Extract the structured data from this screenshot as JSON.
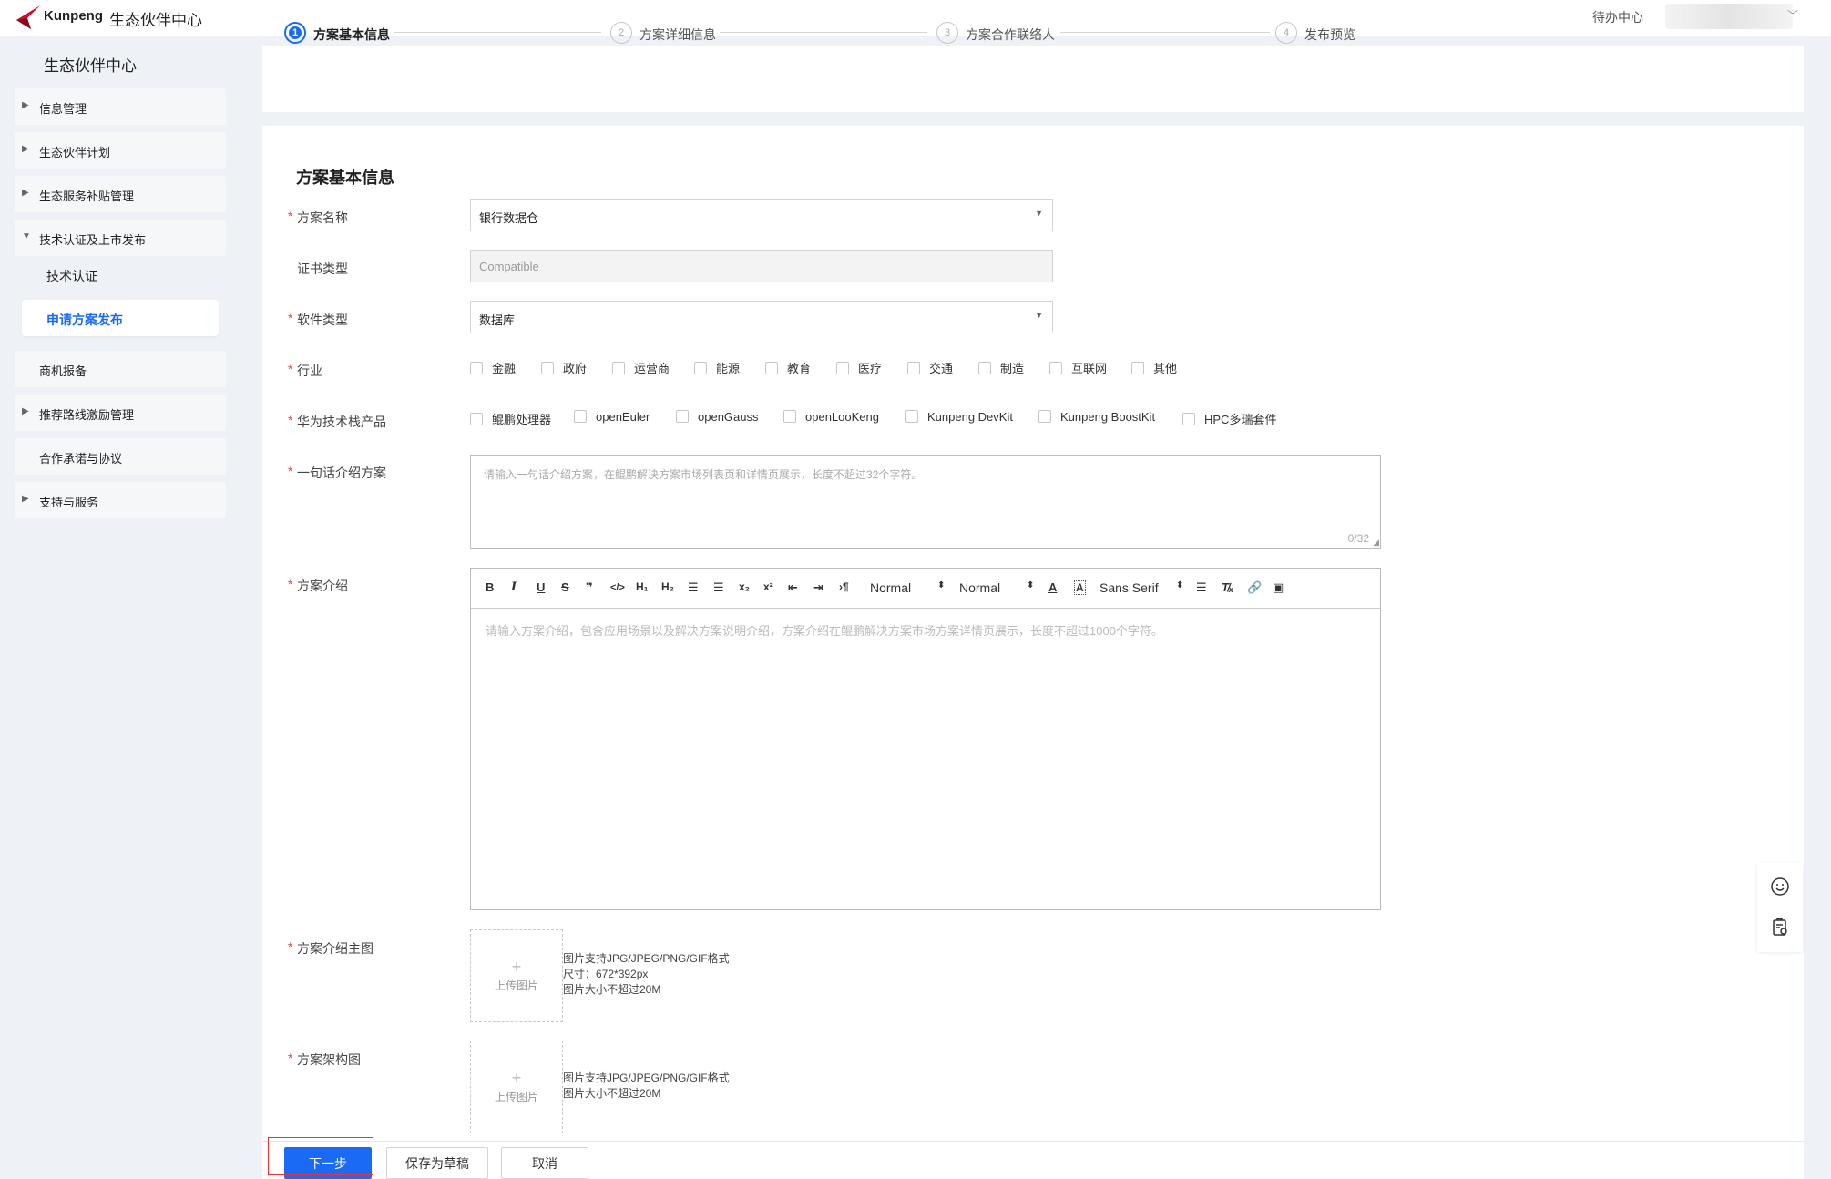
{
  "header": {
    "logo_text": "Kunpeng",
    "app_title": "生态伙伴中心",
    "todo_label": "待办中心"
  },
  "sidebar": {
    "title": "生态伙伴中心",
    "items": [
      {
        "label": "信息管理",
        "arrow": "▶"
      },
      {
        "label": "生态伙伴计划",
        "arrow": "▶"
      },
      {
        "label": "生态服务补贴管理",
        "arrow": "▶"
      },
      {
        "label": "技术认证及上市发布",
        "arrow": "▼"
      },
      {
        "label": "商机报备",
        "arrow": ""
      },
      {
        "label": "推荐路线激励管理",
        "arrow": "▶"
      },
      {
        "label": "合作承诺与协议",
        "arrow": ""
      },
      {
        "label": "支持与服务",
        "arrow": "▶"
      }
    ],
    "sub_items": [
      {
        "label": "技术认证"
      },
      {
        "label": "申请方案发布"
      }
    ]
  },
  "steps": [
    {
      "num": "1",
      "label": "方案基本信息"
    },
    {
      "num": "2",
      "label": "方案详细信息"
    },
    {
      "num": "3",
      "label": "方案合作联络人"
    },
    {
      "num": "4",
      "label": "发布预览"
    }
  ],
  "form": {
    "section_title": "方案基本信息",
    "required_mark": "*",
    "solution_name": {
      "label": "方案名称",
      "value": "银行数据仓"
    },
    "cert_type": {
      "label": "证书类型",
      "value": "Compatible"
    },
    "software_type": {
      "label": "软件类型",
      "value": "数据库"
    },
    "industry": {
      "label": "行业",
      "options": [
        "金融",
        "政府",
        "运营商",
        "能源",
        "教育",
        "医疗",
        "交通",
        "制造",
        "互联网",
        "其他"
      ]
    },
    "tech_stack": {
      "label": "华为技术栈产品",
      "options": [
        "鲲鹏处理器",
        "openEuler",
        "openGauss",
        "openLooKeng",
        "Kunpeng DevKit",
        "Kunpeng BoostKit",
        "HPC多瑞套件"
      ]
    },
    "one_liner": {
      "label": "一句话介绍方案",
      "placeholder": "请输入一句话介绍方案，在鲲鹏解决方案市场列表页和详情页展示，长度不超过32个字符。",
      "count": "0/32"
    },
    "intro": {
      "label": "方案介绍",
      "placeholder": "请输入方案介绍，包含应用场景以及解决方案说明介绍，方案介绍在鲲鹏解决方案市场方案详情页展示，长度不超过1000个字符。",
      "toolbar": {
        "header_select": "Normal",
        "size_select": "Normal",
        "font_select": "Sans Serif"
      }
    },
    "main_image": {
      "label": "方案介绍主图",
      "upload_text": "上传图片",
      "hint_lines": [
        "图片支持JPG/JPEG/PNG/GIF格式",
        "尺寸：672*392px",
        "图片大小不超过20M"
      ]
    },
    "arch_image": {
      "label": "方案架构图",
      "upload_text": "上传图片",
      "hint_lines": [
        "图片支持JPG/JPEG/PNG/GIF格式",
        "图片大小不超过20M"
      ]
    }
  },
  "actions": {
    "next": "下一步",
    "save_draft": "保存为草稿",
    "cancel": "取消"
  },
  "colors": {
    "primary": "#1a6af5",
    "required": "#e64545",
    "focus_outline": "#e33333"
  }
}
